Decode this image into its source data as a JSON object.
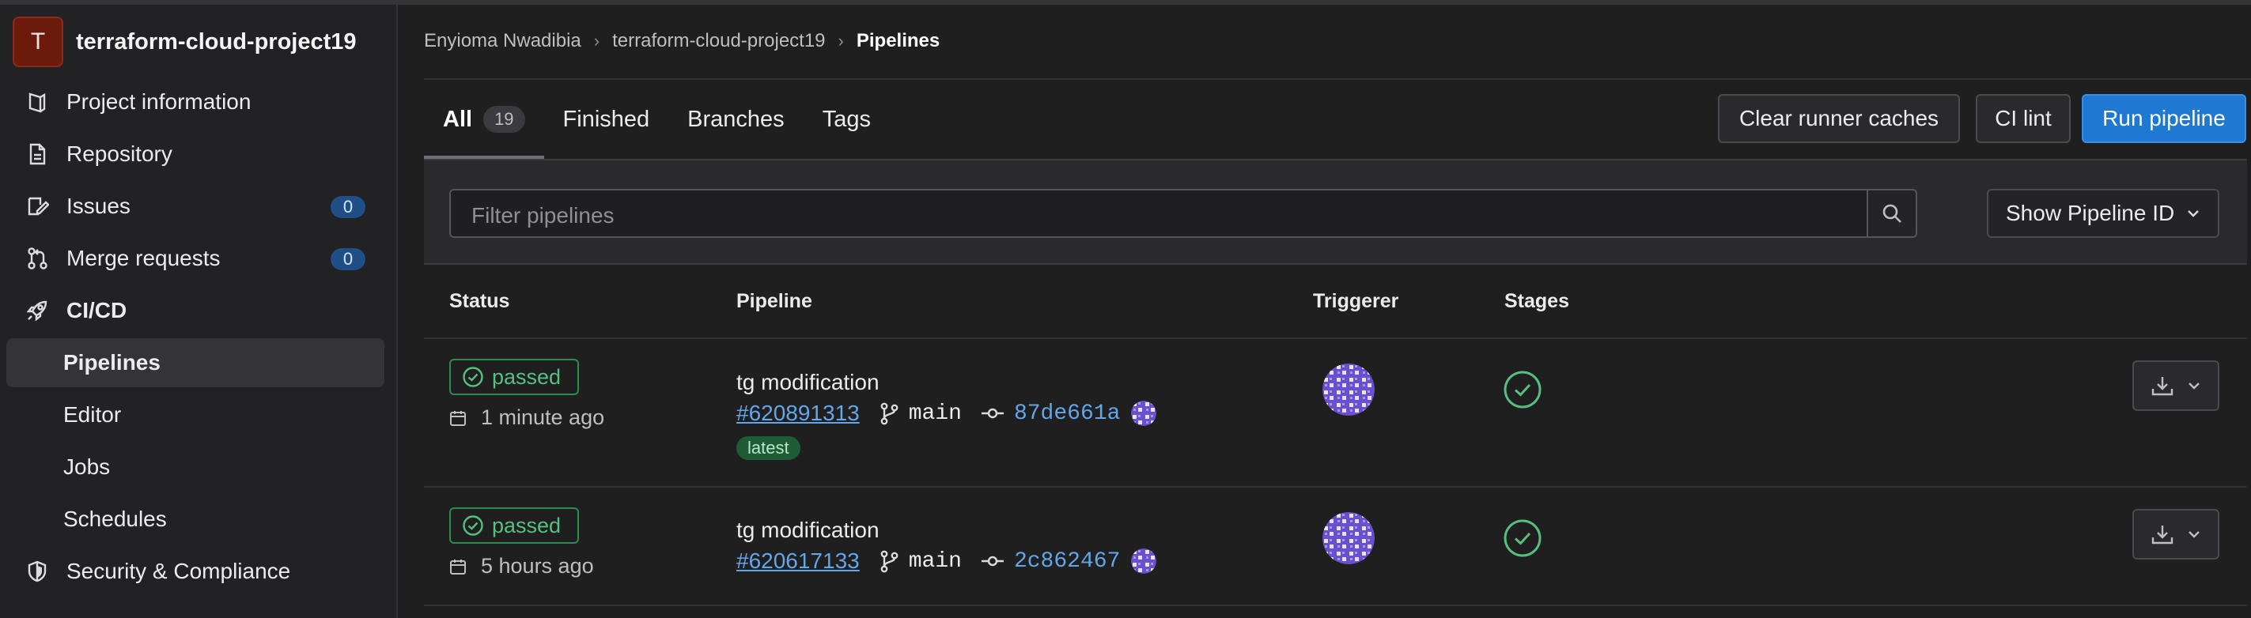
{
  "project": {
    "avatar_letter": "T",
    "name": "terraform-cloud-project19"
  },
  "sidebar": {
    "items": [
      {
        "label": "Project information",
        "icon": "project-icon"
      },
      {
        "label": "Repository",
        "icon": "document-icon"
      },
      {
        "label": "Issues",
        "icon": "issues-icon",
        "count": "0"
      },
      {
        "label": "Merge requests",
        "icon": "merge-request-icon",
        "count": "0"
      },
      {
        "label": "CI/CD",
        "icon": "rocket-icon"
      },
      {
        "label": "Pipelines"
      },
      {
        "label": "Editor"
      },
      {
        "label": "Jobs"
      },
      {
        "label": "Schedules"
      },
      {
        "label": "Security & Compliance",
        "icon": "shield-icon"
      }
    ]
  },
  "breadcrumb": [
    "Enyioma Nwadibia",
    "terraform-cloud-project19",
    "Pipelines"
  ],
  "tabs": [
    {
      "label": "All",
      "count": "19"
    },
    {
      "label": "Finished"
    },
    {
      "label": "Branches"
    },
    {
      "label": "Tags"
    }
  ],
  "actions": {
    "clear_caches": "Clear runner caches",
    "ci_lint": "CI lint",
    "run_pipeline": "Run pipeline"
  },
  "filter": {
    "placeholder": "Filter pipelines",
    "id_dropdown": "Show Pipeline ID"
  },
  "table": {
    "headers": {
      "status": "Status",
      "pipeline": "Pipeline",
      "triggerer": "Triggerer",
      "stages": "Stages"
    },
    "rows": [
      {
        "status": "passed",
        "time": "1 minute ago",
        "title": "tg modification",
        "id": "#620891313",
        "branch": "main",
        "commit": "87de661a",
        "tag": "latest"
      },
      {
        "status": "passed",
        "time": "5 hours ago",
        "title": "tg modification",
        "id": "#620617133",
        "branch": "main",
        "commit": "2c862467"
      }
    ]
  },
  "colors": {
    "accent": "#1f78d1",
    "success": "#55c07f",
    "link": "#63a6e9",
    "project_avatar": "#6b1a0c",
    "user_avatar": "#7b5cd6"
  }
}
